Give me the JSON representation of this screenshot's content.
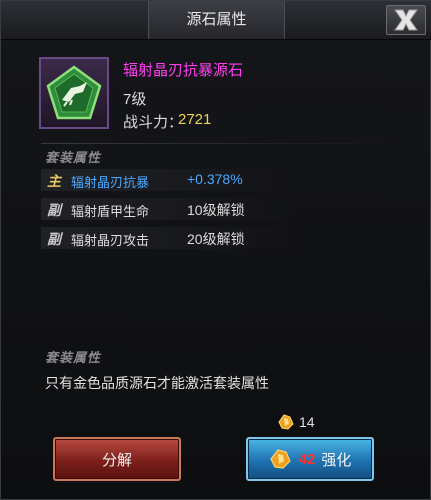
{
  "header": {
    "title": "源石属性",
    "close_icon": "close-icon"
  },
  "item": {
    "icon": "green-pentagon-gem-icon",
    "name": "辐射晶刃抗暴源石",
    "level": "7级",
    "power_label": "战斗力：",
    "power_value": "2721"
  },
  "attributes": {
    "header": "套装属性",
    "rows": [
      {
        "tag": "主",
        "name": "辐射晶刃抗暴",
        "value": "+0.378%",
        "tag_color": "#e8c860",
        "name_color": "#4aa8ff",
        "value_color": "#4aa8ff"
      },
      {
        "tag": "副",
        "name": "辐射盾甲生命",
        "value": "10级解锁",
        "tag_color": "#c8c8c8",
        "name_color": "#dcdcdc",
        "value_color": "#dcdcdc"
      },
      {
        "tag": "副",
        "name": "辐射晶刃攻击",
        "value": "20级解锁",
        "tag_color": "#c8c8c8",
        "name_color": "#dcdcdc",
        "value_color": "#dcdcdc"
      }
    ]
  },
  "set_bonus": {
    "header": "套装属性",
    "description": "只有金色品质源石才能激活套装属性"
  },
  "cost": {
    "icon": "gold-ore-icon",
    "count": "14"
  },
  "buttons": {
    "decompose_label": "分解",
    "enhance_label": "强化",
    "enhance_cost": "42"
  }
}
